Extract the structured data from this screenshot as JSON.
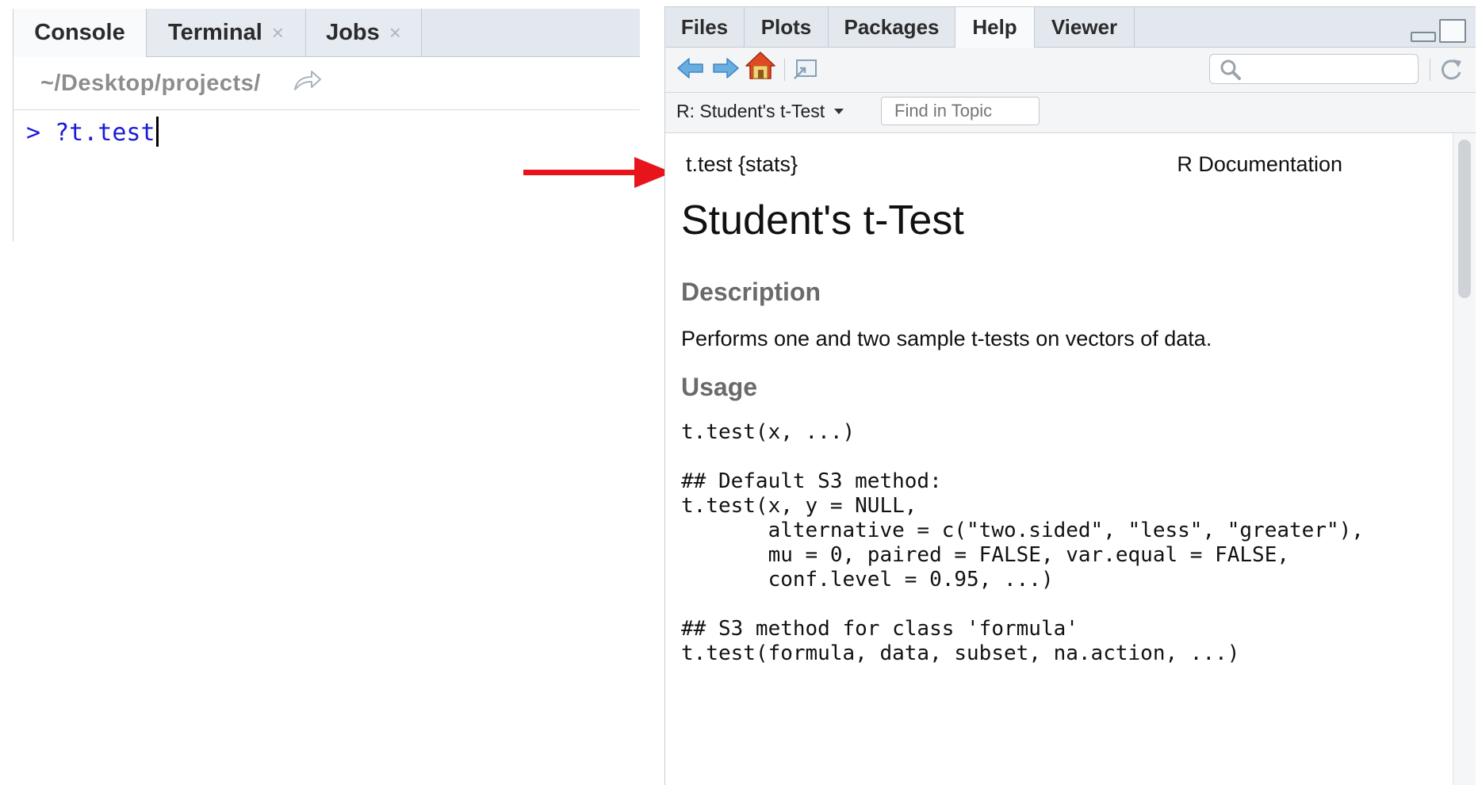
{
  "console_pane": {
    "tabs": [
      {
        "label": "Console",
        "closable": false,
        "active": true
      },
      {
        "label": "Terminal",
        "closable": true,
        "active": false
      },
      {
        "label": "Jobs",
        "closable": true,
        "active": false
      }
    ],
    "close_glyph": "×",
    "path": "~/Desktop/projects/",
    "prompt": "> ?t.test"
  },
  "help_pane": {
    "tabs": [
      {
        "label": "Files",
        "active": false
      },
      {
        "label": "Plots",
        "active": false
      },
      {
        "label": "Packages",
        "active": false
      },
      {
        "label": "Help",
        "active": true
      },
      {
        "label": "Viewer",
        "active": false
      }
    ],
    "toolbar": {
      "icons": [
        "back-arrow-icon",
        "forward-arrow-icon",
        "home-icon",
        "popout-icon",
        "search-icon",
        "refresh-icon"
      ],
      "search_value": ""
    },
    "topic_select": "R: Student's t-Test",
    "find_placeholder": "Find in Topic",
    "doc": {
      "header_left": "t.test {stats}",
      "header_right": "R Documentation",
      "title": "Student's t-Test",
      "description_heading": "Description",
      "description_text": "Performs one and two sample t-tests on vectors of data.",
      "usage_heading": "Usage",
      "usage_code": "t.test(x, ...)\n\n## Default S3 method:\nt.test(x, y = NULL,\n       alternative = c(\"two.sided\", \"less\", \"greater\"),\n       mu = 0, paired = FALSE, var.equal = FALSE,\n       conf.level = 0.95, ...)\n\n## S3 method for class 'formula'\nt.test(formula, data, subset, na.action, ...)"
    }
  },
  "colors": {
    "prompt": "#1b1bd6",
    "arrow": "#e8141b",
    "section_heading": "#6a6a6a",
    "tab_bar": "#e3e8ee"
  }
}
